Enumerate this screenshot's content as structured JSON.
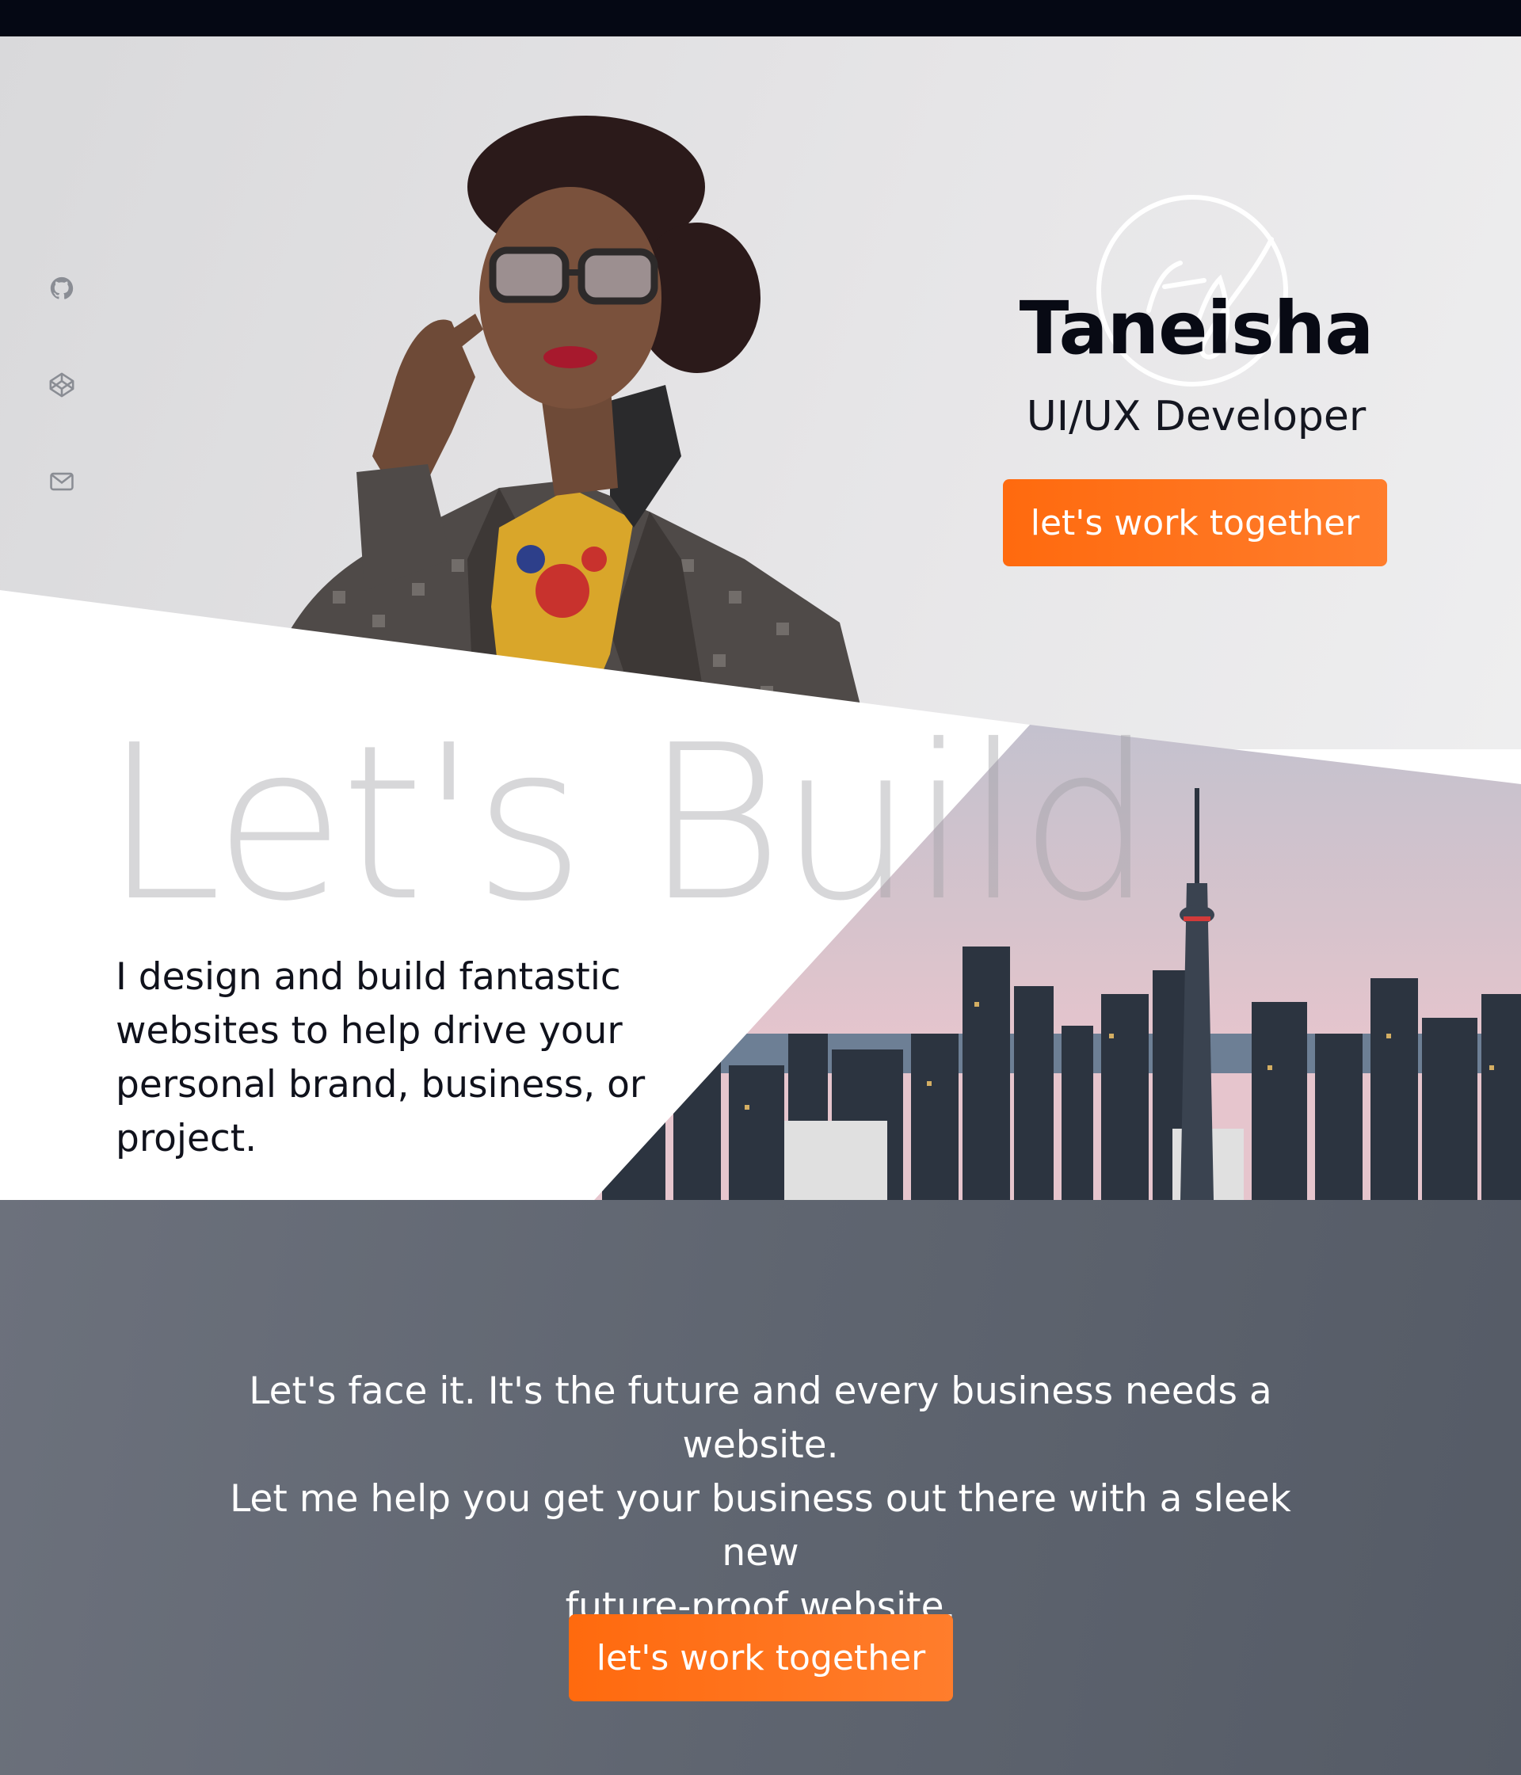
{
  "social_links": [
    {
      "icon": "github-icon",
      "label": "GitHub"
    },
    {
      "icon": "codepen-icon",
      "label": "CodePen"
    },
    {
      "icon": "mail-icon",
      "label": "Email"
    }
  ],
  "hero": {
    "name": "Taneisha",
    "role": "UI/UX Developer",
    "cta_label": "let's work together",
    "logo_icon": "ty-monogram-logo"
  },
  "build": {
    "heading": "Let's Build",
    "text": "I design and build fantastic websites to help drive your personal brand, business, or project."
  },
  "pitch": {
    "line1": "Let's face it. It's the future and every business needs a website.",
    "line2": "Let me help you get your business out there with a sleek new",
    "line3": "future-proof website.",
    "cta_label": "let's work together"
  },
  "colors": {
    "accent": "#ff6a0e",
    "dark_text": "#080a14",
    "pitch_bg": "#5f6570",
    "top_bar": "#050814"
  }
}
